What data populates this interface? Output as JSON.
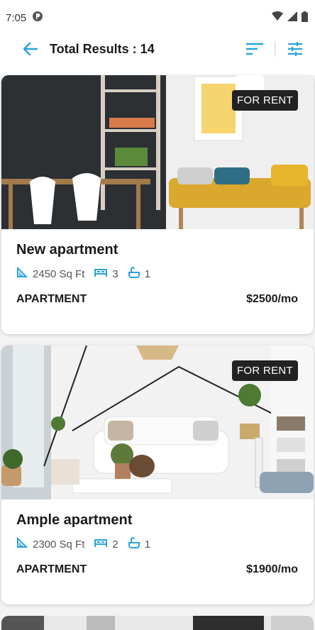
{
  "status": {
    "time": "7:05"
  },
  "header": {
    "title": "Total Results : 14"
  },
  "colors": {
    "accent": "#29a3d9",
    "badge_bg": "#222222"
  },
  "listings": [
    {
      "badge": "FOR RENT",
      "name": "New apartment",
      "area": "2450 Sq Ft",
      "beds": "3",
      "baths": "1",
      "type": "APARTMENT",
      "price": "$2500/mo"
    },
    {
      "badge": "FOR RENT",
      "name": "Ample apartment",
      "area": "2300 Sq Ft",
      "beds": "2",
      "baths": "1",
      "type": "APARTMENT",
      "price": "$1900/mo"
    }
  ]
}
